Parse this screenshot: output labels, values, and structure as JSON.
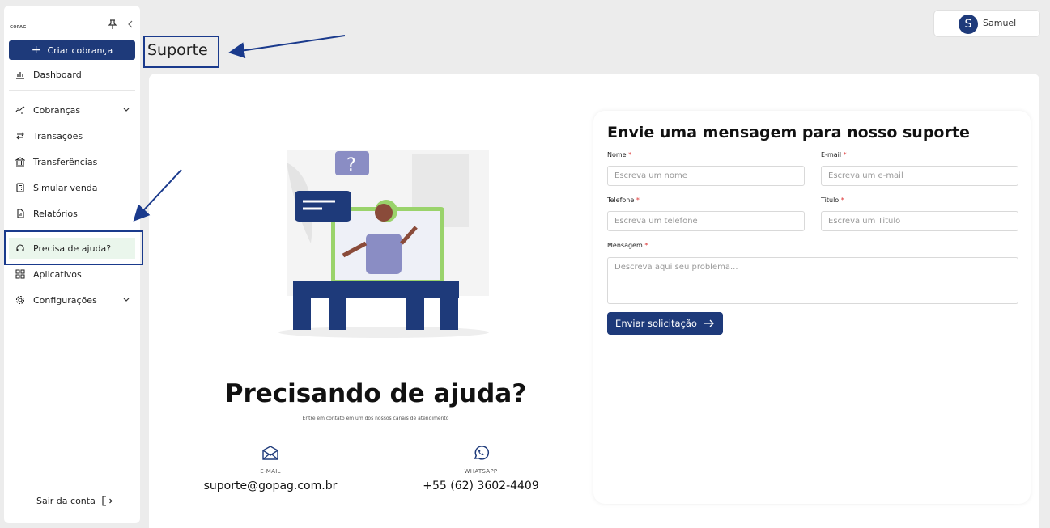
{
  "sidebar": {
    "logo_text": "GOPAG",
    "create_button": "Criar cobrança",
    "items": [
      {
        "label": "Dashboard"
      },
      {
        "label": "Cobranças"
      },
      {
        "label": "Transações"
      },
      {
        "label": "Transferências"
      },
      {
        "label": "Simular venda"
      },
      {
        "label": "Relatórios"
      },
      {
        "label": "Precisa de ajuda?"
      },
      {
        "label": "Aplicativos"
      },
      {
        "label": "Configurações"
      }
    ],
    "logout": "Sair da conta"
  },
  "header": {
    "page_title": "Suporte",
    "user_initial": "S",
    "user_name": "Samuel"
  },
  "help": {
    "title": "Precisando de ajuda?",
    "subtitle": "Entre em contato em um dos nossos canais de atendimento",
    "email_label": "E-MAIL",
    "email_value": "suporte@gopag.com.br",
    "whatsapp_label": "WHATSAPP",
    "whatsapp_value": "+55 (62) 3602-4409"
  },
  "form": {
    "title": "Envie uma mensagem para nosso suporte",
    "name_label": "Nome",
    "name_placeholder": "Escreva um nome",
    "email_label": "E-mail",
    "email_placeholder": "Escreva um e-mail",
    "phone_label": "Telefone",
    "phone_placeholder": "Escreva um telefone",
    "title_label": "Titulo",
    "title_placeholder": "Escreva um Titulo",
    "message_label": "Mensagem",
    "message_placeholder": "Descreva aqui seu problema...",
    "required_mark": "*",
    "submit": "Enviar solicitação"
  },
  "colors": {
    "primary": "#1e3a7a",
    "active_bg": "#eaf6ec",
    "background": "#ececec",
    "annotation": "#1a3a8c"
  }
}
